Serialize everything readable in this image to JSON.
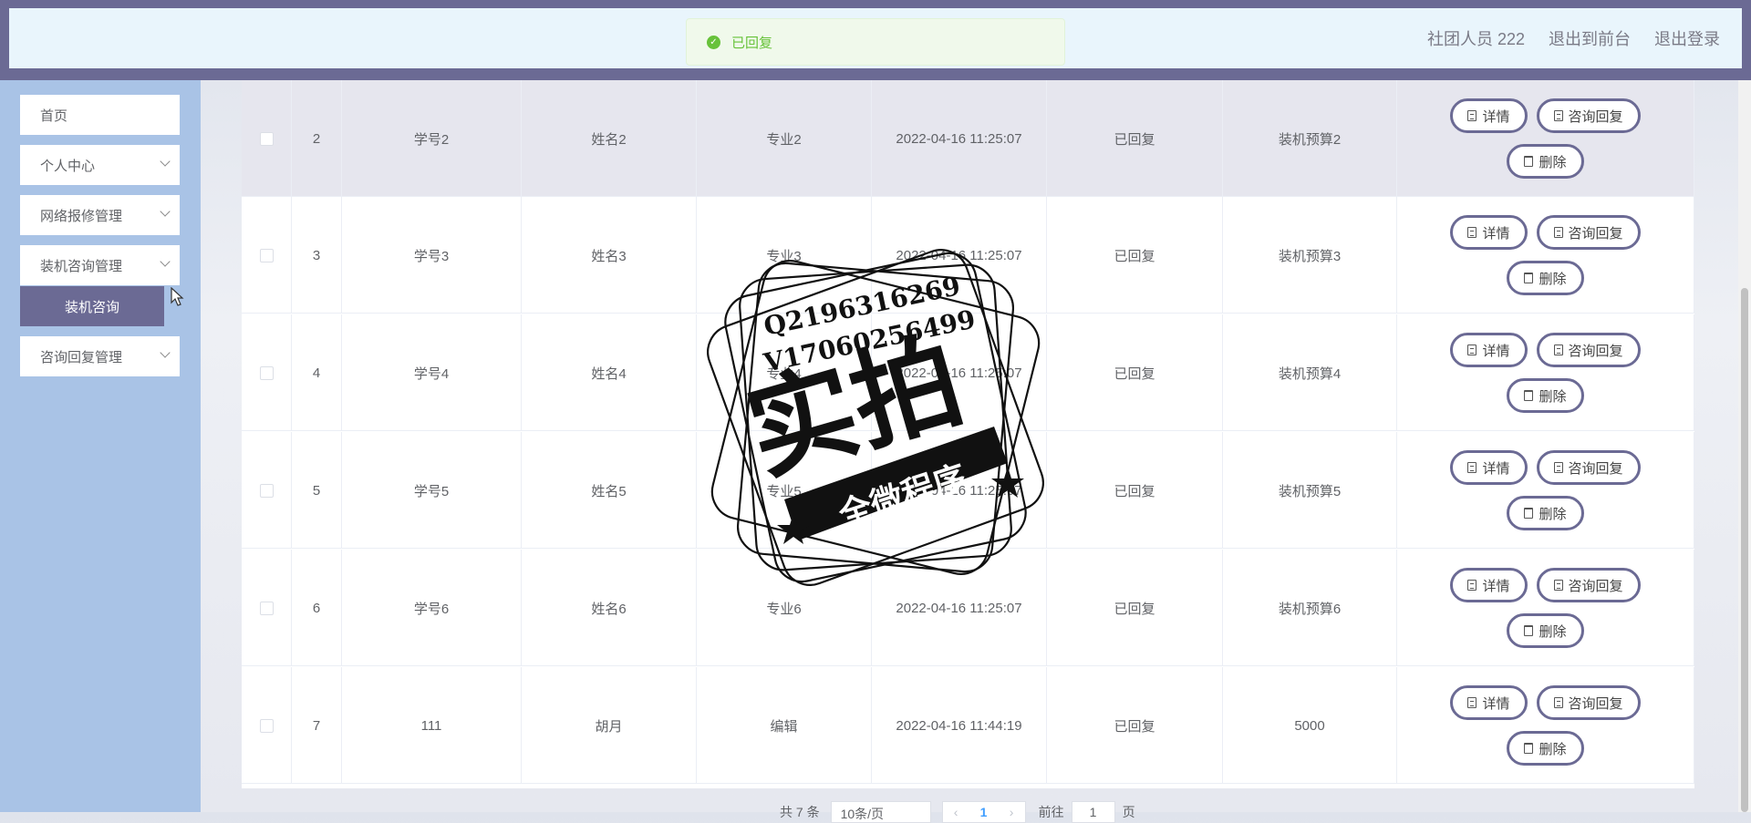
{
  "header": {
    "user": "社团人员 222",
    "to_front": "退出到前台",
    "logout": "退出登录"
  },
  "toast": {
    "text": "已回复",
    "icon": "check-circle-icon",
    "color": "#67c23a"
  },
  "sidebar": {
    "items": [
      {
        "label": "首页"
      },
      {
        "label": "个人中心"
      },
      {
        "label": "网络报修管理"
      },
      {
        "label": "装机咨询管理"
      },
      {
        "label": "咨询回复管理"
      }
    ],
    "active_sub": "装机咨询"
  },
  "table": {
    "rows": [
      {
        "index": "2",
        "sid": "学号2",
        "name": "姓名2",
        "major": "专业2",
        "time": "2022-04-16 11:25:07",
        "status": "已回复",
        "budget": "装机预算2"
      },
      {
        "index": "3",
        "sid": "学号3",
        "name": "姓名3",
        "major": "专业3",
        "time": "2022-04-16 11:25:07",
        "status": "已回复",
        "budget": "装机预算3"
      },
      {
        "index": "4",
        "sid": "学号4",
        "name": "姓名4",
        "major": "专业4",
        "time": "2022-04-16 11:25:07",
        "status": "已回复",
        "budget": "装机预算4"
      },
      {
        "index": "5",
        "sid": "学号5",
        "name": "姓名5",
        "major": "专业5",
        "time": "2022-04-16 11:25:07",
        "status": "已回复",
        "budget": "装机预算5"
      },
      {
        "index": "6",
        "sid": "学号6",
        "name": "姓名6",
        "major": "专业6",
        "time": "2022-04-16 11:25:07",
        "status": "已回复",
        "budget": "装机预算6"
      },
      {
        "index": "7",
        "sid": "111",
        "name": "胡月",
        "major": "编辑",
        "time": "2022-04-16 11:44:19",
        "status": "已回复",
        "budget": "5000"
      }
    ],
    "actions": {
      "detail": "详情",
      "reply": "咨询回复",
      "delete": "删除"
    }
  },
  "pagination": {
    "total": "共 7 条",
    "page_size": "10条/页",
    "current": "1",
    "goto_prefix": "前往",
    "goto_value": "1",
    "goto_suffix": "页"
  },
  "watermark": {
    "line1": "Q2196316269",
    "line2": "V17060256499",
    "main": "实拍",
    "banner": "全微程序"
  }
}
